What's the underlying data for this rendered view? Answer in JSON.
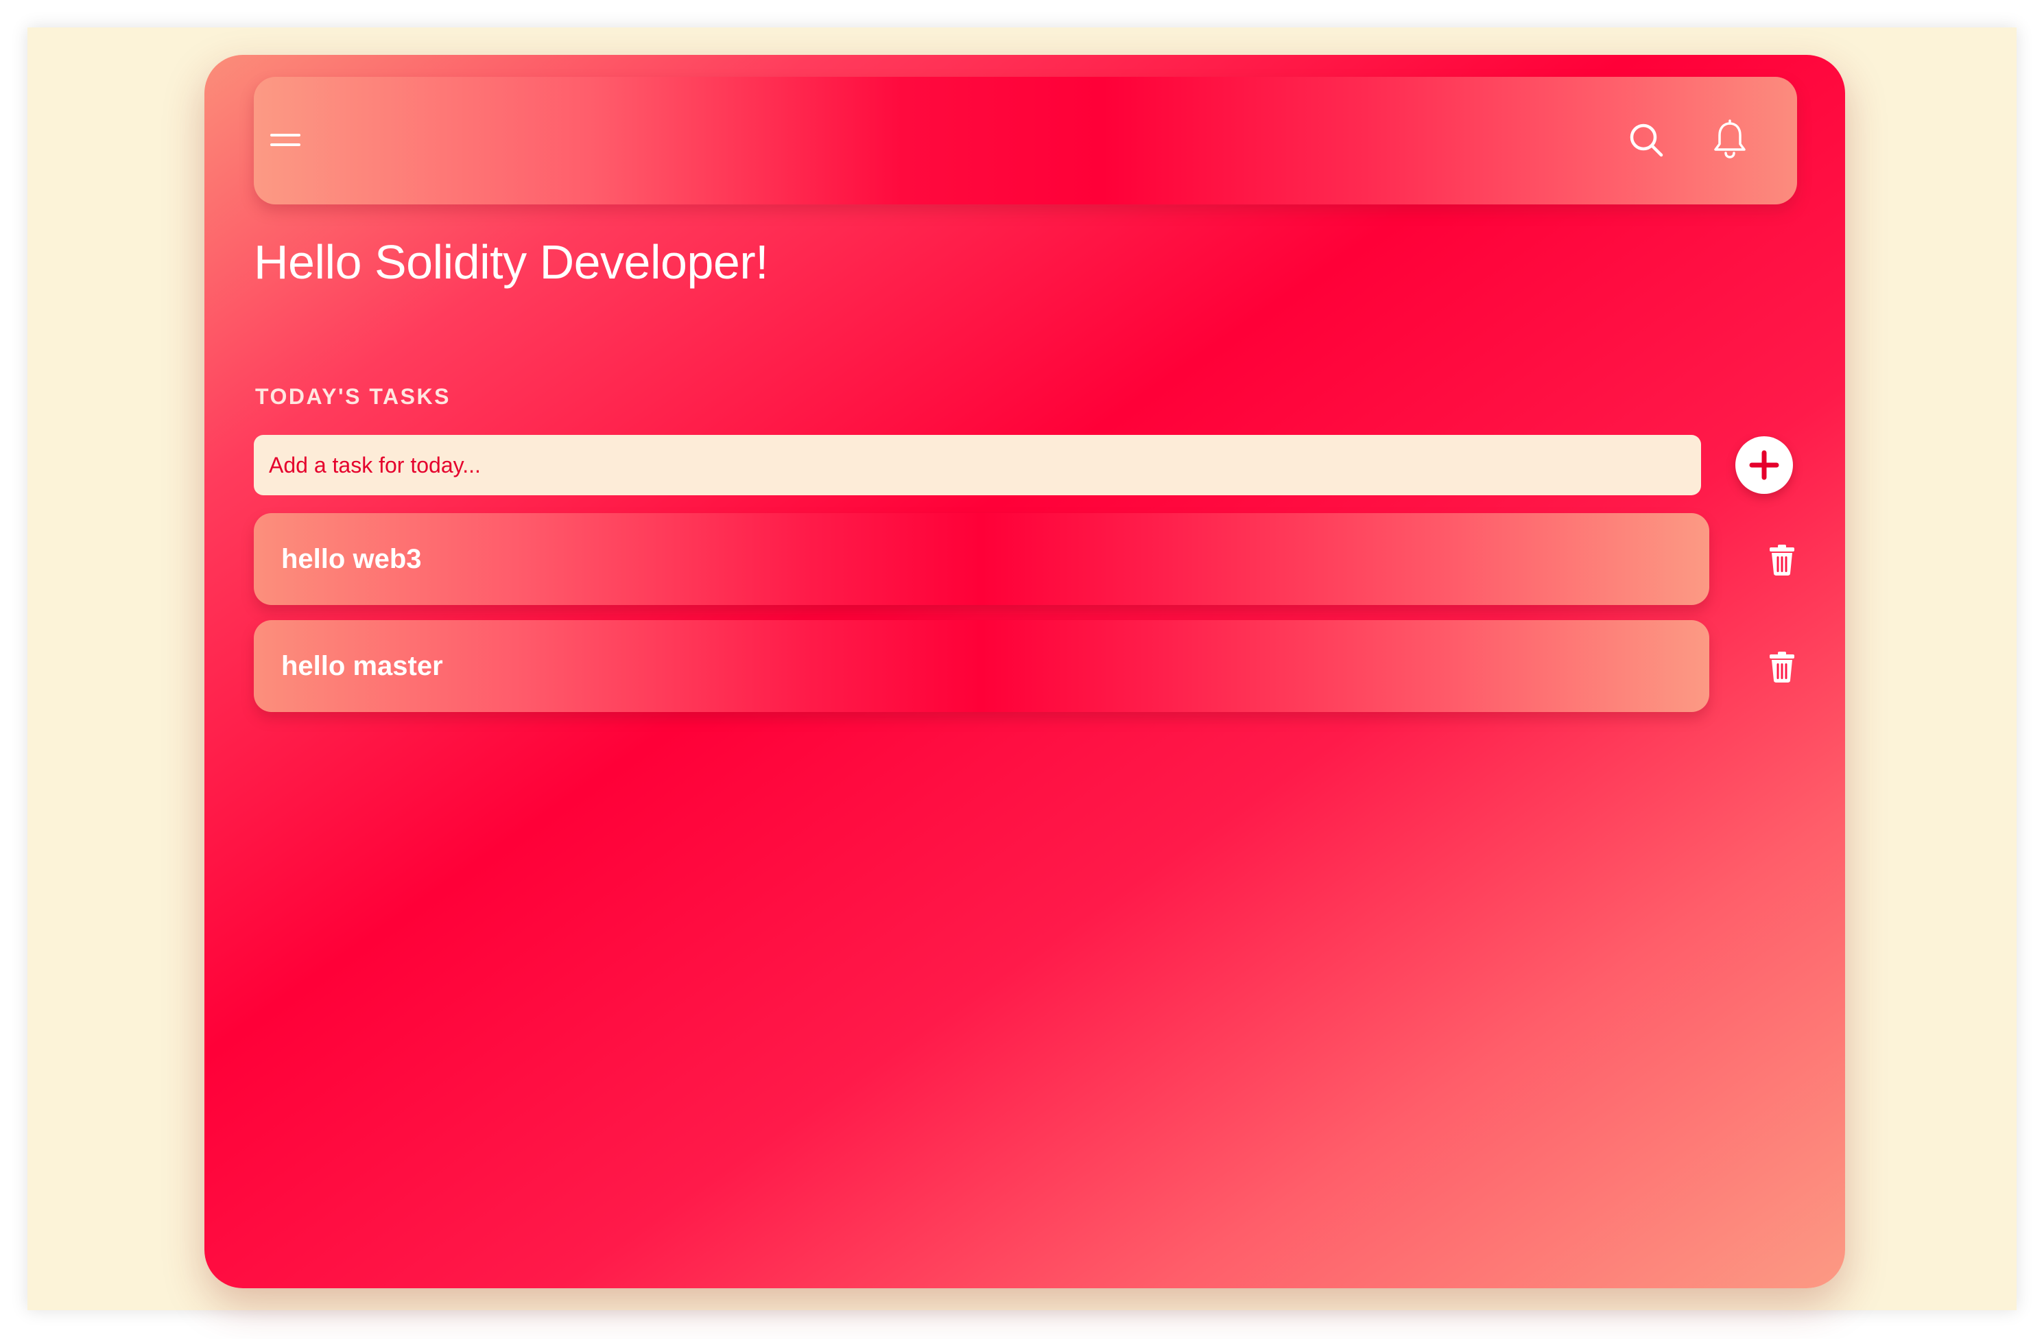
{
  "header": {
    "menu_icon": "hamburger-menu-icon",
    "search_icon": "search-icon",
    "notification_icon": "bell-icon"
  },
  "greeting": "Hello Solidity Developer!",
  "tasks_section": {
    "label": "TODAY'S TASKS",
    "input_placeholder": "Add a task for today...",
    "input_value": "",
    "add_icon": "plus-icon",
    "delete_icon": "trash-icon",
    "items": [
      {
        "text": "hello web3"
      },
      {
        "text": "hello master"
      }
    ]
  },
  "colors": {
    "page_background": "#fcf3d8",
    "accent": "#ff0038",
    "gradient_light": "#fc9a84",
    "input_background": "#fdecd8",
    "input_text": "#e5002c",
    "text_on_accent": "#ffffff"
  }
}
